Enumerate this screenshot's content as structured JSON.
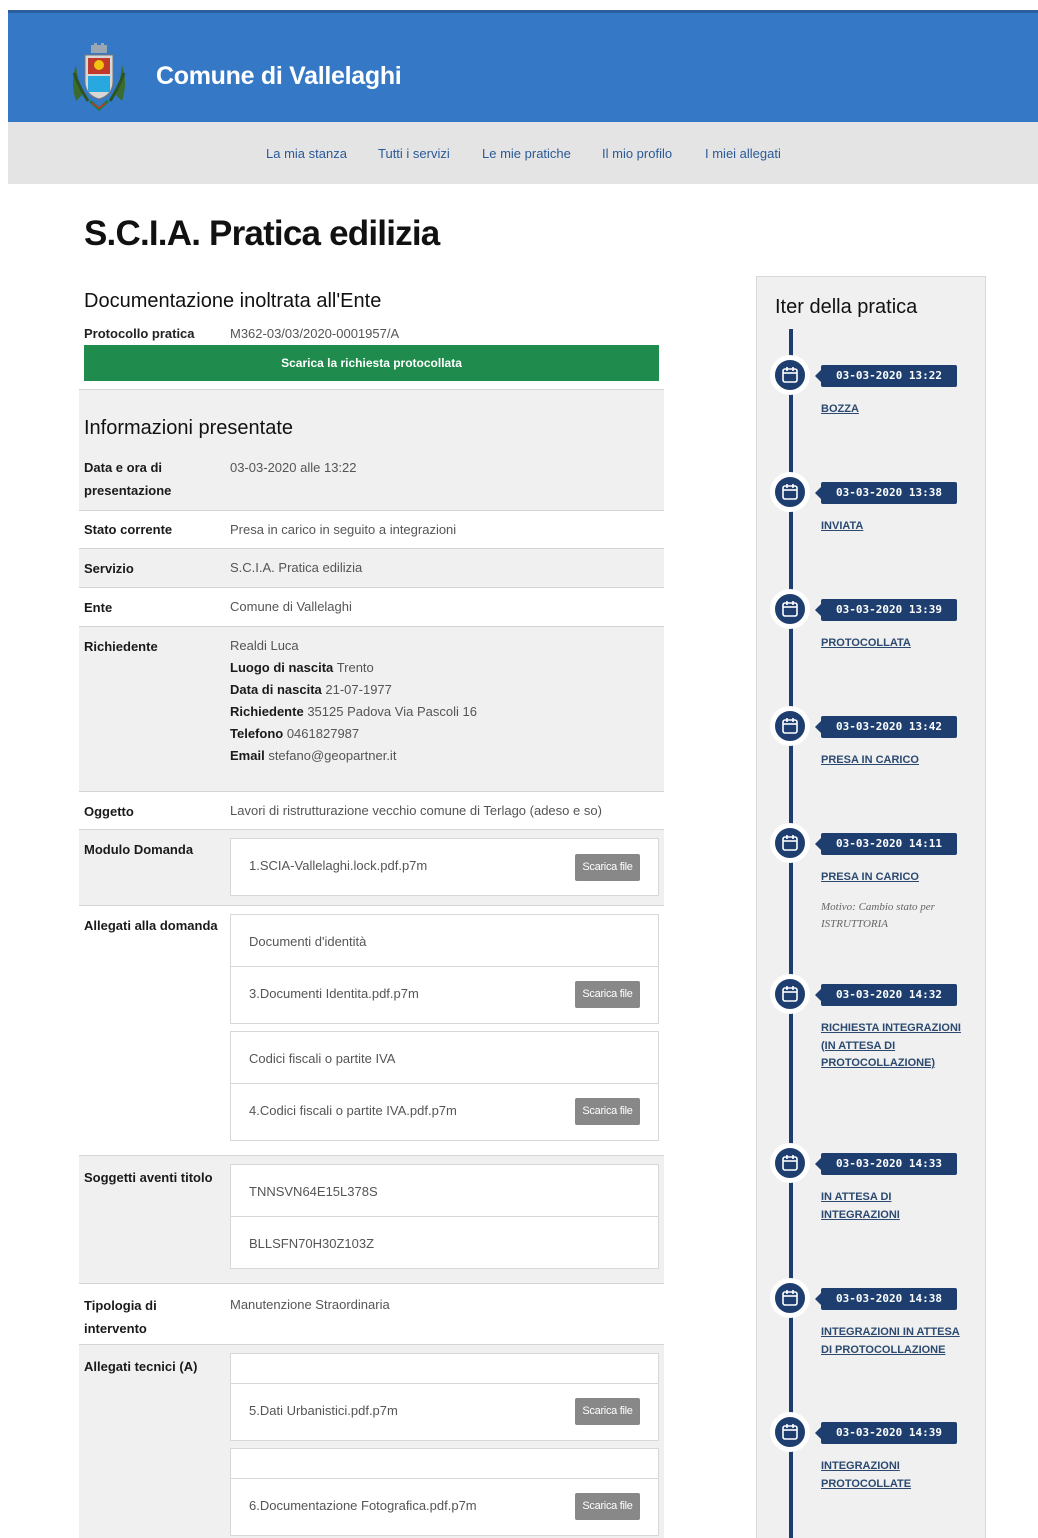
{
  "header": {
    "title": "Comune di Vallelaghi",
    "color": "#3579c6"
  },
  "nav": {
    "items": [
      "La mia stanza",
      "Tutti i servizi",
      "Le mie pratiche",
      "Il mio profilo",
      "I miei allegati"
    ]
  },
  "page": {
    "title": "S.C.I.A. Pratica edilizia",
    "doc_section_title": "Documentazione inoltrata all'Ente",
    "protocol_label": "Protocollo pratica",
    "protocol_value": "M362-03/03/2020-0001957/A",
    "download_label": "Scarica la richiesta protocollata",
    "info_section_title": "Informazioni presentate",
    "file_button_label": "Scarica file"
  },
  "rows": {
    "date_label": "Data e ora di presentazione",
    "date_value": "03-03-2020 alle 13:22",
    "status_label": "Stato corrente",
    "status_value": "Presa in carico in seguito a integrazioni",
    "service_label": "Servizio",
    "service_value": "S.C.I.A. Pratica edilizia",
    "ente_label": "Ente",
    "ente_value": "Comune di Vallelaghi",
    "applicant_label": "Richiedente",
    "applicant": {
      "name": "Realdi Luca",
      "birthplace_label": "Luogo di nascita",
      "birthplace": "Trento",
      "birthdate_label": "Data di nascita",
      "birthdate": "21-07-1977",
      "address_label": "Richiedente",
      "address": "35125 Padova Via Pascoli 16",
      "phone_label": "Telefono",
      "phone": "0461827987",
      "email_label": "Email",
      "email": "stefano@geopartner.it"
    },
    "object_label": "Oggetto",
    "object_value": "Lavori di ristrutturazione vecchio comune di Terlago (adeso e so)",
    "form_label": "Modulo Domanda",
    "form_file": "1.SCIA-Vallelaghi.lock.pdf.p7m",
    "attachments_label": "Allegati alla domanda",
    "attachments": [
      {
        "category": "Documenti d'identità",
        "file": "3.Documenti Identita.pdf.p7m"
      },
      {
        "category": "Codici fiscali o partite IVA",
        "file": "4.Codici fiscali o partite IVA.pdf.p7m"
      }
    ],
    "subjects_label": "Soggetti aventi titolo",
    "subjects": [
      "TNNSVN64E15L378S",
      "BLLSFN70H30Z103Z"
    ],
    "intervention_label": "Tipologia di intervento",
    "intervention_value": "Manutenzione Straordinaria",
    "tech_label": "Allegati tecnici (A)",
    "tech_files": [
      "5.Dati Urbanistici.pdf.p7m",
      "6.Documentazione Fotografica.pdf.p7m"
    ]
  },
  "timeline": {
    "title": "Iter della pratica",
    "events": [
      {
        "date": "03-03-2020 13:22",
        "state": "BOZZA"
      },
      {
        "date": "03-03-2020 13:38",
        "state": "INVIATA"
      },
      {
        "date": "03-03-2020 13:39",
        "state": "PROTOCOLLATA"
      },
      {
        "date": "03-03-2020 13:42",
        "state": "PRESA IN CARICO"
      },
      {
        "date": "03-03-2020 14:11",
        "state": "PRESA IN CARICO",
        "note": "Motivo: Cambio stato per ISTRUTTORIA"
      },
      {
        "date": "03-03-2020 14:32",
        "state": "RICHIESTA INTEGRAZIONI (IN ATTESA DI PROTOCOLLAZIONE)"
      },
      {
        "date": "03-03-2020 14:33",
        "state": "IN ATTESA DI INTEGRAZIONI"
      },
      {
        "date": "03-03-2020 14:38",
        "state": "INTEGRAZIONI IN ATTESA DI PROTOCOLLAZIONE"
      },
      {
        "date": "03-03-2020 14:39",
        "state": "INTEGRAZIONI PROTOCOLLATE"
      }
    ]
  },
  "colors": {
    "brand_blue": "#3579c6",
    "download_green": "#1f8b4d",
    "timeline_navy": "#1d3e6e",
    "file_button": "#888888"
  }
}
